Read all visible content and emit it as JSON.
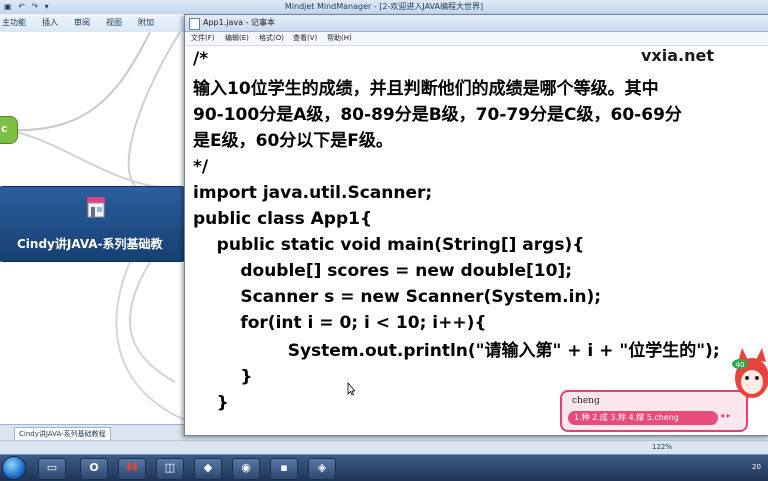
{
  "mindmanager": {
    "title": "Mindjet MindManager - [2-欢迎进入JAVA编程大世界]",
    "tabs": [
      "主功能",
      "插入",
      "审阅",
      "视图",
      "附加"
    ],
    "central_topic": "Cindy讲JAVA-系列基础教",
    "sheet_tab": "Cindy讲JAVA-系列基础教程",
    "zoom": "122%"
  },
  "notepad": {
    "title": "App1.java - 记事本",
    "menu": [
      "文件(F)",
      "编辑(E)",
      "格式(O)",
      "查看(V)",
      "帮助(H)"
    ],
    "watermark": "vxia.net",
    "code_lines": [
      "/*",
      "输入10位学生的成绩，并且判断他们的成绩是哪个等级。其中",
      "90-100分是A级，80-89分是B级，70-79分是C级，60-69分",
      "是E级，60分以下是F级。",
      "*/",
      "import java.util.Scanner;",
      "public class App1{",
      "    public static void main(String[] args){",
      "        double[] scores = new double[10];",
      "        Scanner s = new Scanner(System.in);",
      "        for(int i = 0; i < 10; i++){",
      "                System.out.println(\"请输入第\" + i + \"位学生的\");",
      "        }",
      "    }"
    ]
  },
  "ime": {
    "input": "cheng",
    "candidates": "1.种  2.成  3.称  4.撑  5.cheng"
  },
  "mascot_badge": "40",
  "taskbar": {
    "time": "20"
  },
  "colors": {
    "ime_accent": "#e2406f",
    "central_topic": "#1f4c86",
    "left_topic": "#7bc043"
  }
}
